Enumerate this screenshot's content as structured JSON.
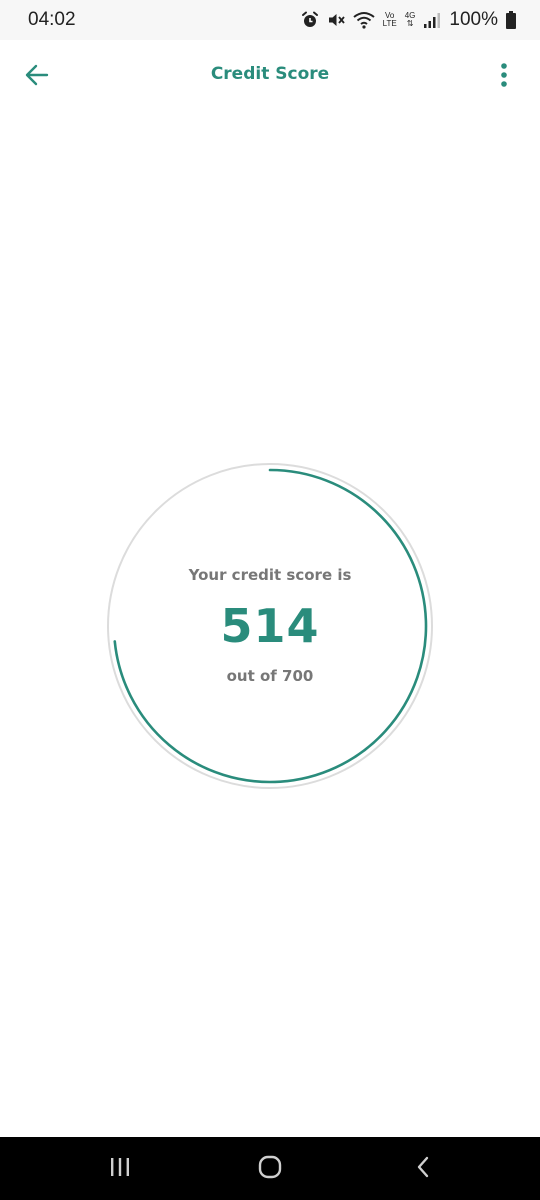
{
  "status_bar": {
    "time": "04:02",
    "volte_top": "Vo",
    "volte_bottom": "LTE",
    "network": "4G",
    "battery": "100%",
    "icons": [
      "alarm-icon",
      "mute-icon",
      "wifi-icon",
      "volte-icon",
      "network-4g-icon",
      "signal-icon",
      "battery-icon"
    ]
  },
  "app_bar": {
    "title": "Credit Score",
    "back_icon": "arrow-left-icon",
    "menu_icon": "more-vert-icon"
  },
  "credit_score": {
    "label": "Your credit score is",
    "score": 514,
    "score_text": "514",
    "max": 700,
    "max_text": "out of 700"
  },
  "nav_bar": {
    "icons": [
      "recent-apps-icon",
      "home-icon",
      "back-icon"
    ]
  },
  "colors": {
    "accent": "#2a8c7c",
    "ring_track": "#dcdcdc",
    "secondary_text": "#777777",
    "status_bar_bg": "#f7f7f7",
    "nav_bar_bg": "#000000"
  }
}
